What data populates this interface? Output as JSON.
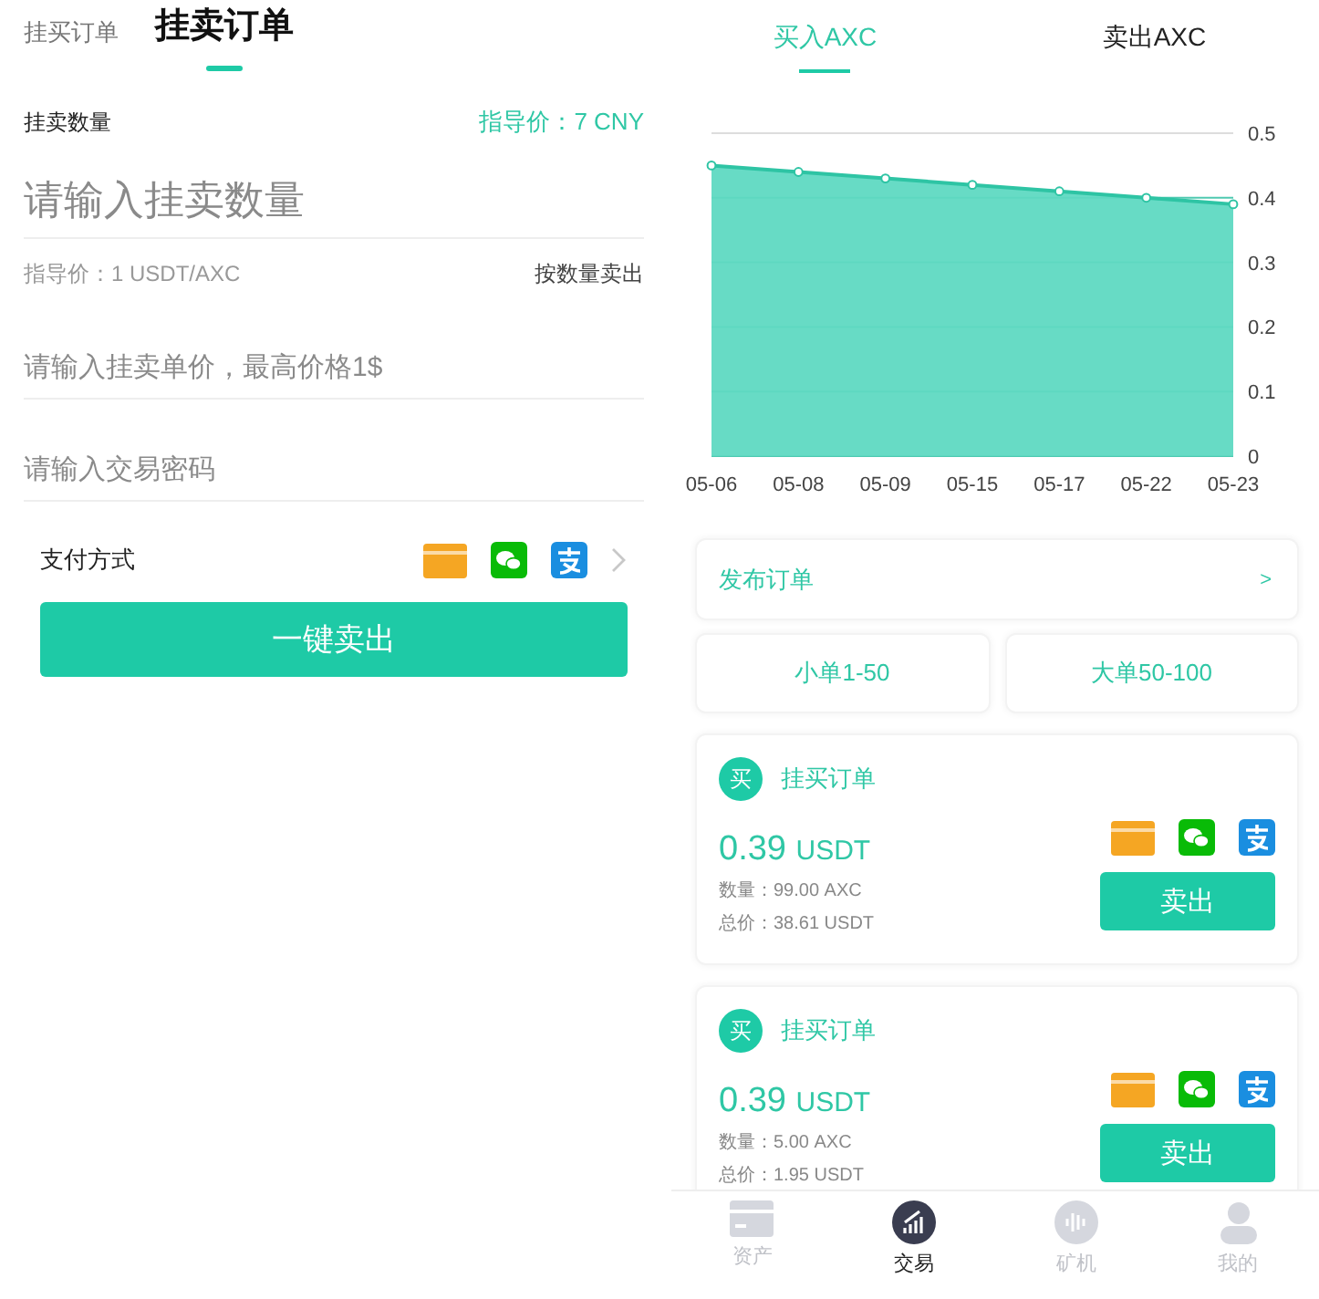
{
  "sell_form": {
    "tabs": [
      {
        "label": "挂买订单",
        "selected": false
      },
      {
        "label": "挂卖订单",
        "selected": true
      }
    ],
    "quantity_label": "挂卖数量",
    "guide_price": "指导价：7 CNY",
    "quantity_field": {
      "placeholder": "请输入挂卖数量"
    },
    "unit_guide": "指导价：1 USDT/AXC",
    "sell_by_quantity": "按数量卖出",
    "price_field": {
      "placeholder": "请输入挂卖单价，最高价格1$"
    },
    "password_field": {
      "placeholder": "请输入交易密码"
    },
    "payment_label": "支付方式",
    "payment_icons": [
      {
        "kind": "card"
      },
      {
        "kind": "wechat"
      },
      {
        "kind": "alipay"
      }
    ],
    "submit": "一键卖出"
  },
  "market": {
    "tabs": [
      {
        "label": "买入AXC",
        "selected": true
      },
      {
        "label": "卖出AXC",
        "selected": false
      }
    ],
    "chart_data": {
      "type": "area",
      "categories": [
        "05-06",
        "05-08",
        "05-09",
        "05-15",
        "05-17",
        "05-22",
        "05-23"
      ],
      "grid": true,
      "series": [
        {
          "color": "#5fd9c2",
          "values": [
            0.45,
            0.44,
            0.43,
            0.42,
            0.41,
            0.4,
            0.39
          ]
        }
      ],
      "ylim": [
        0,
        0.5
      ],
      "yticks": [
        0,
        0.1,
        0.2,
        0.3,
        0.4,
        0.5
      ]
    },
    "publish": {
      "label": "发布订单",
      "arrow": ">"
    },
    "filters": [
      {
        "label": "小单1-50"
      },
      {
        "label": "大单50-100"
      }
    ],
    "orders": [
      {
        "badge": "买",
        "title": "挂买订单",
        "price": "0.39",
        "unit": "USDT",
        "quantity": "数量：99.00 AXC",
        "total": "总价：38.61 USDT",
        "payment_icons": [
          {
            "kind": "card"
          },
          {
            "kind": "wechat"
          },
          {
            "kind": "alipay"
          }
        ],
        "action": "卖出"
      },
      {
        "badge": "买",
        "title": "挂买订单",
        "price": "0.39",
        "unit": "USDT",
        "quantity": "数量：5.00 AXC",
        "total": "总价：1.95 USDT",
        "payment_icons": [
          {
            "kind": "card"
          },
          {
            "kind": "wechat"
          },
          {
            "kind": "alipay"
          }
        ],
        "action": "卖出"
      }
    ]
  },
  "bottom_nav": [
    {
      "kind": "wallet",
      "label": "资产",
      "selected": false
    },
    {
      "kind": "trade",
      "label": "交易",
      "selected": true
    },
    {
      "kind": "miner",
      "label": "矿机",
      "selected": false
    },
    {
      "kind": "profile",
      "label": "我的",
      "selected": false
    }
  ]
}
